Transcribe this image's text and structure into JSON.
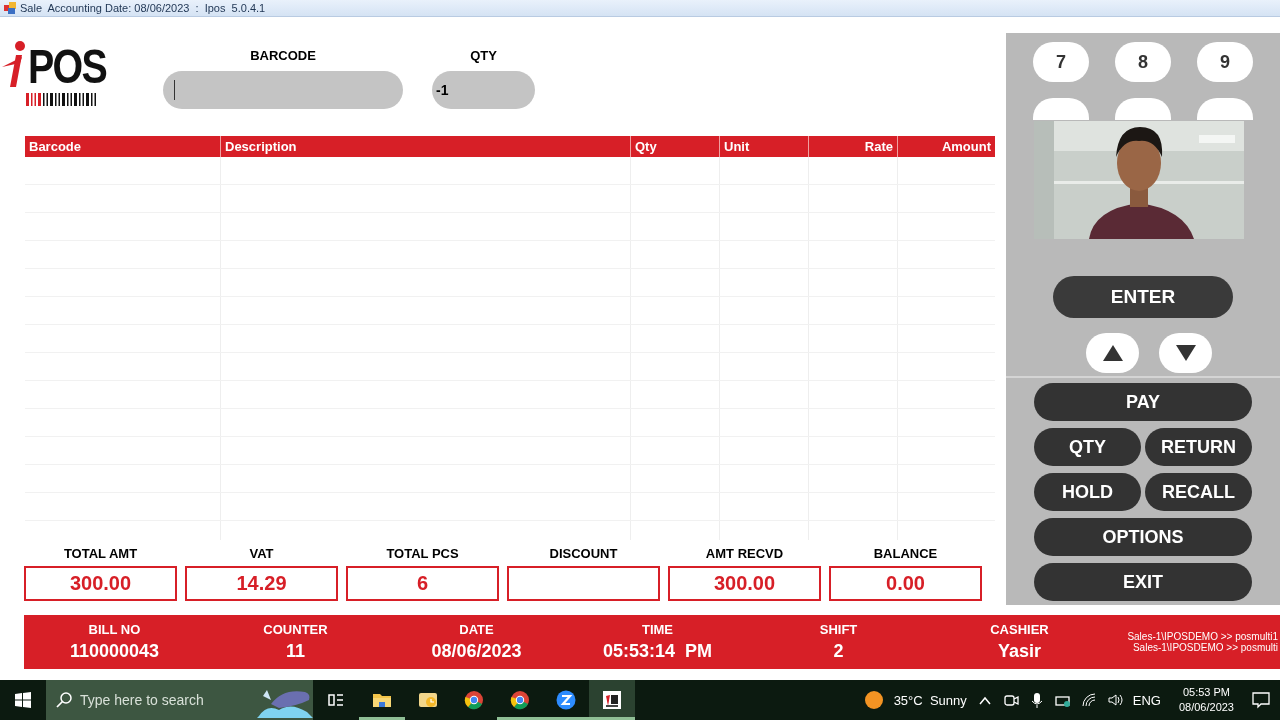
{
  "window": {
    "title": "Sale  Accounting Date: 08/06/2023  :  Ipos  5.0.4.1"
  },
  "logo": {
    "text": "POS"
  },
  "entry": {
    "barcode_label": "BARCODE",
    "qty_label": "QTY",
    "qty_value": "-1"
  },
  "table": {
    "columns": [
      {
        "label": "Barcode"
      },
      {
        "label": "Description"
      },
      {
        "label": "Qty"
      },
      {
        "label": "Unit"
      },
      {
        "label": "Rate"
      },
      {
        "label": "Amount"
      }
    ]
  },
  "totals": [
    {
      "label": "TOTAL AMT",
      "value": "300.00"
    },
    {
      "label": "VAT",
      "value": "14.29"
    },
    {
      "label": "TOTAL PCS",
      "value": "6"
    },
    {
      "label": "DISCOUNT"
    },
    {
      "label": "AMT RECVD",
      "value": "300.00"
    },
    {
      "label": "BALANCE",
      "value": "0.00"
    }
  ],
  "info": [
    {
      "label": "BILL NO",
      "value": "110000043"
    },
    {
      "label": "COUNTER",
      "value": "11"
    },
    {
      "label": "DATE",
      "value": "08/06/2023"
    },
    {
      "label": "TIME",
      "value": "05:53:14  PM"
    },
    {
      "label": "SHIFT",
      "value": "2"
    },
    {
      "label": "CASHIER",
      "value": "Yasir"
    }
  ],
  "session_lines": [
    "Sales-1\\IPOSDEMO >> posmulti1",
    "Sales-1\\IPOSDEMO >> posmulti"
  ],
  "keypad": [
    "7",
    "8",
    "9"
  ],
  "enter": "ENTER",
  "action_rows": [
    [
      "PAY"
    ],
    [
      "QTY",
      "RETURN"
    ],
    [
      "HOLD",
      "RECALL"
    ],
    [
      "OPTIONS"
    ],
    [
      "EXIT"
    ]
  ],
  "webcam": {
    "kind": "picture"
  },
  "taskbar": {
    "search_placeholder": "Type here to search",
    "apps": [
      {
        "kind": "taskview",
        "running": false,
        "selected": false
      },
      {
        "kind": "folder",
        "running": true,
        "selected": false
      },
      {
        "kind": "mail",
        "running": false,
        "selected": false
      },
      {
        "kind": "chrome",
        "running": false,
        "selected": false
      },
      {
        "kind": "chrome",
        "running": true,
        "selected": false
      },
      {
        "kind": "zoom",
        "running": true,
        "selected": false
      },
      {
        "kind": "pos",
        "running": true,
        "selected": true
      }
    ],
    "weather": "35°C  Sunny",
    "language": "ENG",
    "time": "05:53 PM",
    "date": "08/06/2023"
  }
}
